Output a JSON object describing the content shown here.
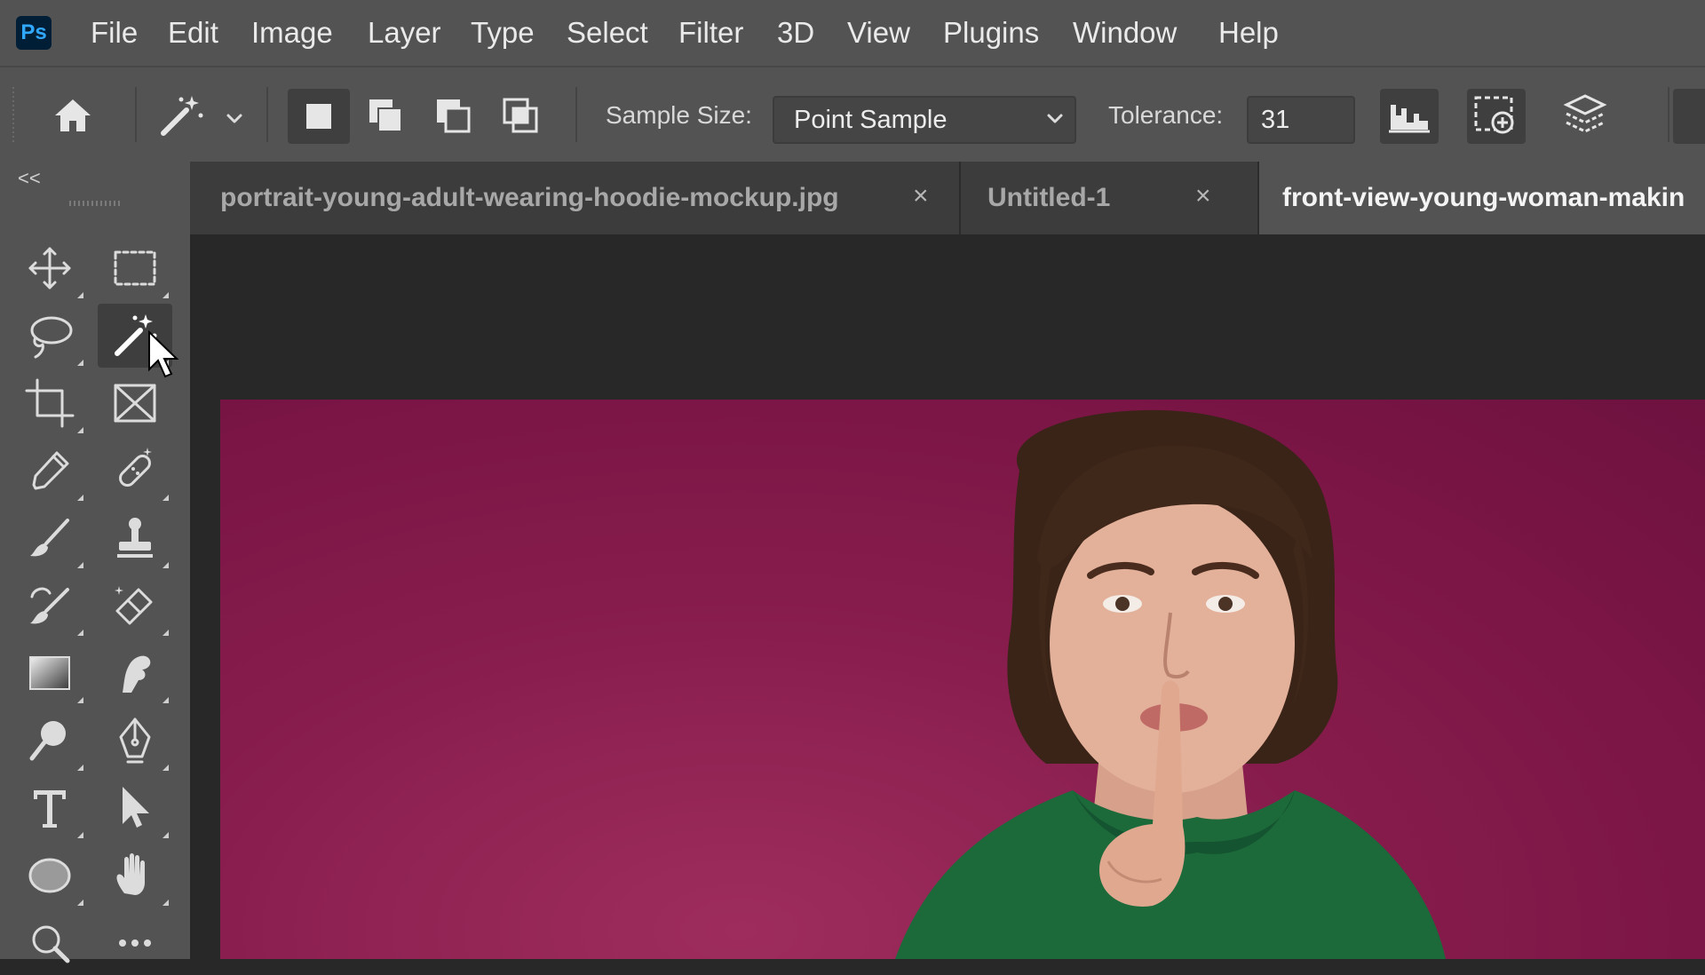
{
  "app": {
    "logo_text": "Ps"
  },
  "menu": {
    "items": [
      "File",
      "Edit",
      "Image",
      "Layer",
      "Type",
      "Select",
      "Filter",
      "3D",
      "View",
      "Plugins",
      "Window",
      "Help"
    ]
  },
  "options_bar": {
    "sample_size_label": "Sample Size:",
    "sample_size_value": "Point Sample",
    "tolerance_label": "Tolerance:",
    "tolerance_value": "31"
  },
  "toolbar": {
    "collapse_glyph": "<<",
    "selected_tool": "magic-wand-tool"
  },
  "tabs": [
    {
      "label": "portrait-young-adult-wearing-hoodie-mockup.jpg",
      "close": "×",
      "active": false
    },
    {
      "label": "Untitled-1",
      "close": "×",
      "active": false
    },
    {
      "label": "front-view-young-woman-makin",
      "active": true
    }
  ],
  "canvas": {
    "background_color": "#8a1d4e",
    "hoodie_color": "#1c6a3a"
  },
  "icons": [
    "home-icon",
    "magic-wand-icon",
    "chevron-down-icon",
    "new-selection-icon",
    "add-to-selection-icon",
    "subtract-from-selection-icon",
    "intersect-selection-icon",
    "sample-all-layers-icon",
    "select-subject-icon",
    "select-layers-icon"
  ]
}
